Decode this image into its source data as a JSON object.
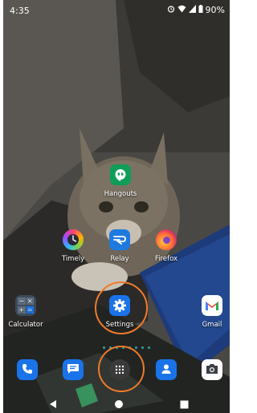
{
  "status_bar": {
    "time": "4:35",
    "battery": "90%"
  },
  "apps": {
    "hangouts": "Hangouts",
    "timely": "Timely",
    "relay": "Relay",
    "firefox": "Firefox",
    "calculator": "Calculator",
    "settings": "Settings",
    "gmail": "Gmail"
  },
  "dock": [
    "phone",
    "messages",
    "app-drawer",
    "contacts",
    "camera"
  ],
  "colors": {
    "highlight_ring": "#f07a2c",
    "settings_blue": "#1a73e8",
    "hangouts_green": "#0f9d58"
  }
}
